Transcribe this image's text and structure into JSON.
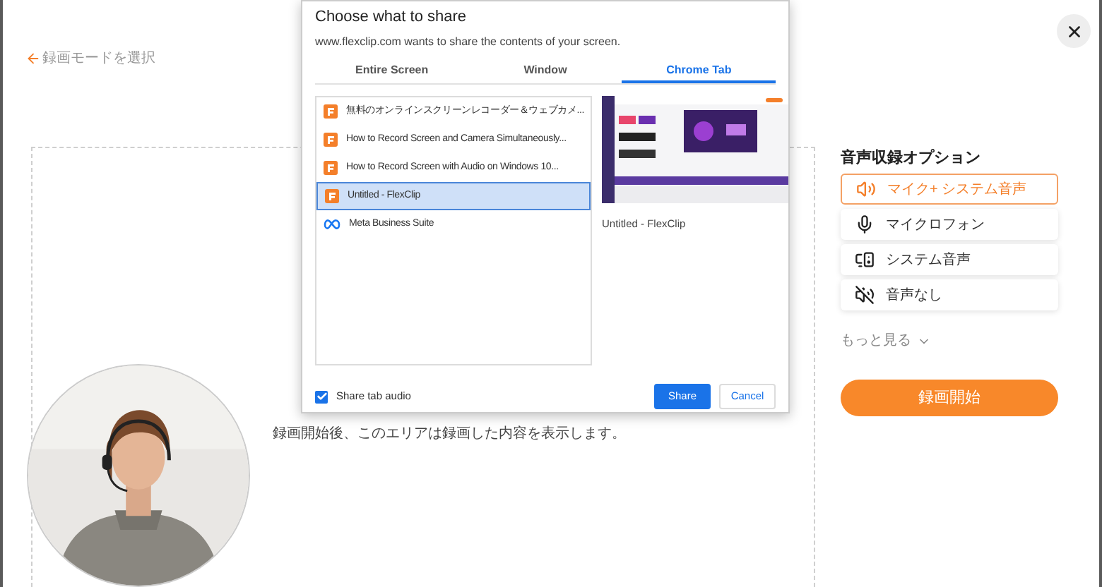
{
  "back_link": "録画モードを選択",
  "recording_area": {
    "message": "録画開始後、このエリアは録画した内容を表示します。"
  },
  "audio_options": {
    "title": "音声収録オプション",
    "options": [
      {
        "kind": "mic_system",
        "label": "マイク+ システム音声",
        "selected": true
      },
      {
        "kind": "mic",
        "label": "マイクロフォン",
        "selected": false
      },
      {
        "kind": "system",
        "label": "システム音声",
        "selected": false
      },
      {
        "kind": "none",
        "label": "音声なし",
        "selected": false
      }
    ],
    "more": "もっと見る",
    "start_button": "録画開始"
  },
  "dialog": {
    "title": "Choose what to share",
    "subtitle": "www.flexclip.com wants to share the contents of your screen.",
    "tabs": [
      {
        "label": "Entire Screen",
        "selected": false
      },
      {
        "label": "Window",
        "selected": false
      },
      {
        "label": "Chrome Tab",
        "selected": true
      }
    ],
    "items": [
      {
        "kind": "flexclip",
        "label": "無料のオンラインスクリーンレコーダー＆ウェブカメ...",
        "selected": false
      },
      {
        "kind": "flexclip",
        "label": "How to Record Screen and Camera Simultaneously...",
        "selected": false
      },
      {
        "kind": "flexclip",
        "label": "How to Record Screen with Audio on Windows 10...",
        "selected": false
      },
      {
        "kind": "flexclip",
        "label": "Untitled - FlexClip",
        "selected": true
      },
      {
        "kind": "meta",
        "label": "Meta Business Suite",
        "selected": false
      }
    ],
    "preview": {
      "kind": "picture",
      "caption": "Untitled - FlexClip"
    },
    "share_audio": {
      "label": "Share tab audio",
      "checked": true
    },
    "buttons": [
      {
        "kind": "primary",
        "label": "Share"
      },
      {
        "kind": "secondary",
        "label": "Cancel"
      }
    ]
  }
}
